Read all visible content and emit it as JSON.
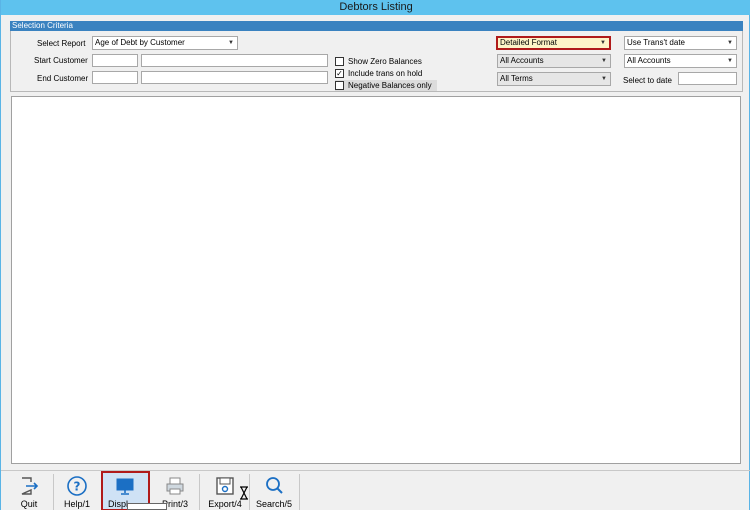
{
  "window": {
    "title": "Debtors Listing"
  },
  "selection": {
    "header": "Selection Criteria",
    "select_report_label": "Select Report",
    "select_report_value": "Age of Debt by Customer",
    "start_customer_label": "Start Customer",
    "end_customer_label": "End Customer",
    "start_customer_code": "",
    "start_customer_name": "",
    "end_customer_code": "",
    "end_customer_name": "",
    "checkboxes": [
      {
        "label": "Show Zero Balances",
        "checked": false
      },
      {
        "label": "Include trans on hold",
        "checked": true
      },
      {
        "label": "Negative Balances only",
        "checked": false
      }
    ],
    "format_value": "Detailed Format",
    "accounts_value_1": "All Accounts",
    "terms_value": "All Terms",
    "date_mode_value": "Use Trans't date",
    "accounts_value_2": "All Accounts",
    "select_to_date_label": "Select to date",
    "select_to_date_value": ""
  },
  "toolbar": {
    "quit": "Quit",
    "help": "Help/1",
    "display": "Displ",
    "print": "Print/3",
    "export": "Export/4",
    "search": "Search/5"
  },
  "colors": {
    "titlebar": "#5ec2ee",
    "group_header": "#3a82c0",
    "highlight_border": "#b01a1a",
    "icon_blue": "#1b6fc4"
  }
}
